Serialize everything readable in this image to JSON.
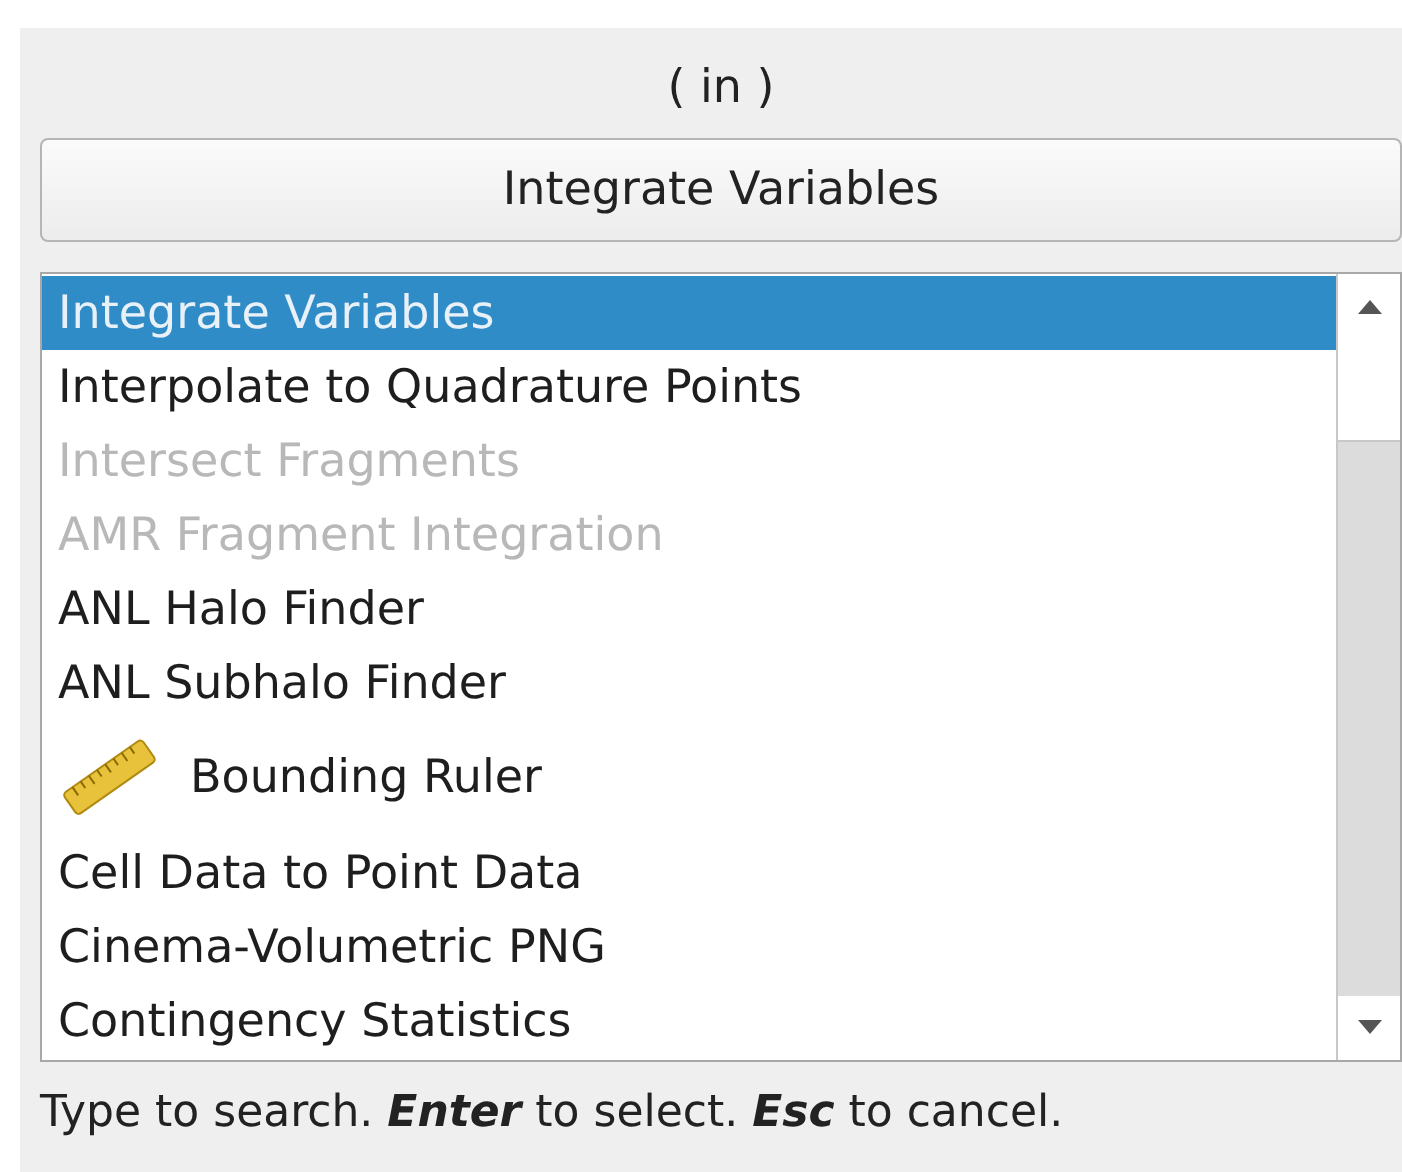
{
  "label": "( in )",
  "button": "Integrate Variables",
  "items": [
    {
      "label": "Integrate Variables",
      "selected": true,
      "disabled": false,
      "kind": "plain"
    },
    {
      "label": "Interpolate to Quadrature Points",
      "selected": false,
      "disabled": false,
      "kind": "plain"
    },
    {
      "label": "Intersect Fragments",
      "selected": false,
      "disabled": true,
      "kind": "plain"
    },
    {
      "label": "AMR Fragment Integration",
      "selected": false,
      "disabled": true,
      "kind": "plain"
    },
    {
      "label": "ANL Halo Finder",
      "selected": false,
      "disabled": false,
      "kind": "plain"
    },
    {
      "label": "ANL Subhalo Finder",
      "selected": false,
      "disabled": false,
      "kind": "plain"
    },
    {
      "label": "Bounding Ruler",
      "selected": false,
      "disabled": false,
      "kind": "ruler"
    },
    {
      "label": "Cell Data to Point Data",
      "selected": false,
      "disabled": false,
      "kind": "plain"
    },
    {
      "label": "Cinema-Volumetric PNG",
      "selected": false,
      "disabled": false,
      "kind": "plain"
    },
    {
      "label": "Contingency Statistics",
      "selected": false,
      "disabled": false,
      "kind": "plain"
    }
  ],
  "hint": "Type to search. **Enter** to select. **Esc** to cancel."
}
